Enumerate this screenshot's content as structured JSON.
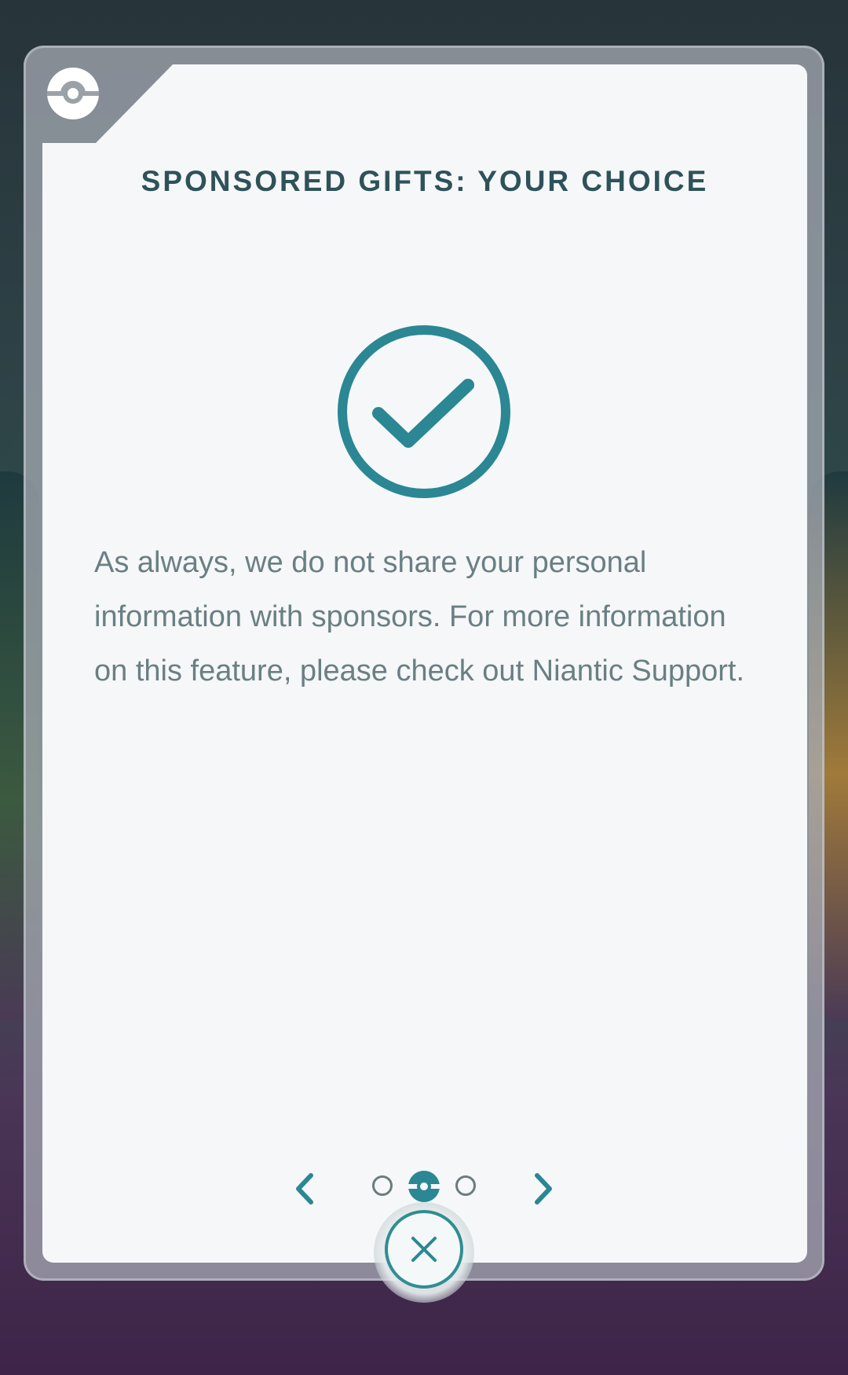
{
  "dialog": {
    "title": "SPONSORED GIFTS: YOUR CHOICE",
    "body": "As always, we do not share your personal information with sponsors. For more information on this feature, please check out Niantic Support."
  },
  "icons": {
    "header": "pokeball-icon",
    "status": "checkmark-circle-icon",
    "prev": "chevron-left-icon",
    "next": "chevron-right-icon",
    "close": "close-icon"
  },
  "pagination": {
    "total_pages": 3,
    "current_page": 2
  },
  "colors": {
    "accent": "#2a8793",
    "title": "#2e525a",
    "body_text": "#6a7f84",
    "panel": "#f6f7f8"
  }
}
